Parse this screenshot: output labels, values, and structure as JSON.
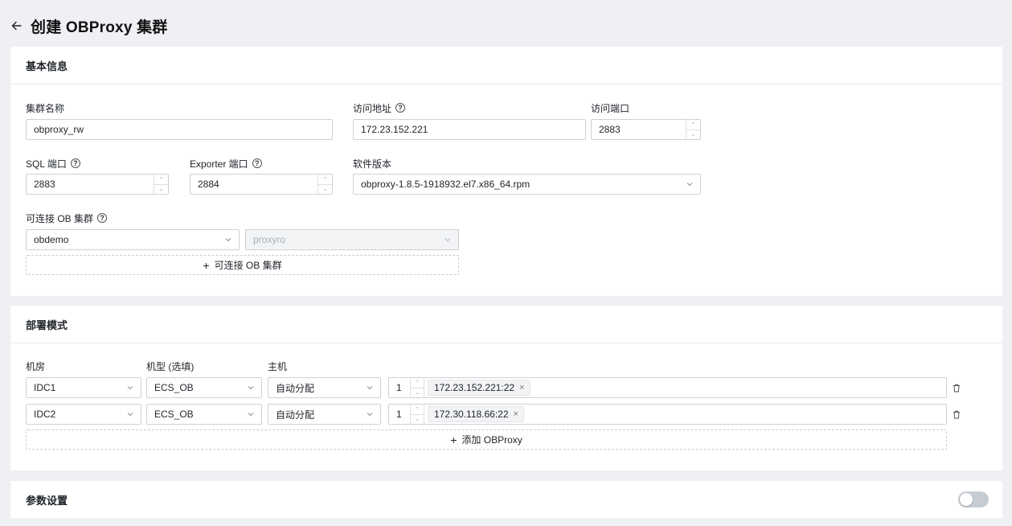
{
  "page": {
    "title": "创建 OBProxy 集群"
  },
  "basic": {
    "section_title": "基本信息",
    "cluster_name": {
      "label": "集群名称",
      "value": "obproxy_rw"
    },
    "access_address": {
      "label": "访问地址",
      "value": "172.23.152.221"
    },
    "access_port": {
      "label": "访问端口",
      "value": "2883"
    },
    "sql_port": {
      "label": "SQL 端口",
      "value": "2883"
    },
    "exporter_port": {
      "label": "Exporter 端口",
      "value": "2884"
    },
    "software_version": {
      "label": "软件版本",
      "value": "obproxy-1.8.5-1918932.el7.x86_64.rpm"
    },
    "ob_cluster": {
      "label": "可连接 OB 集群",
      "cluster_value": "obdemo",
      "tenant_value": "proxyro",
      "add_label": "可连接 OB 集群"
    }
  },
  "deploy": {
    "section_title": "部署模式",
    "col_idc": "机房",
    "col_type": "机型 (选填)",
    "col_host": "主机",
    "rows": [
      {
        "idc": "IDC1",
        "type": "ECS_OB",
        "host_mode": "自动分配",
        "count": "1",
        "host": "172.23.152.221:22"
      },
      {
        "idc": "IDC2",
        "type": "ECS_OB",
        "host_mode": "自动分配",
        "count": "1",
        "host": "172.30.118.66:22"
      }
    ],
    "add_label": "添加 OBProxy"
  },
  "params": {
    "section_title": "参数设置",
    "enabled": false
  },
  "icons": {
    "back": "arrow-left-icon",
    "help": "question-circle-icon",
    "chevron": "chevron-down-icon",
    "delete": "trash-icon",
    "plus": "plus-icon",
    "close": "close-icon"
  },
  "colors": {
    "background": "#eef0f4",
    "border": "#cdd1d8",
    "toggle_off": "#c7ccd4"
  }
}
